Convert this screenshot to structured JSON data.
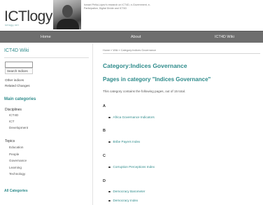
{
  "site": {
    "logo": "ICTlogy",
    "logo_sub": "ictlogy.net",
    "tagline": "Ismael Peña-López's research on ICT4D, e-Government, e-Participation, Digital Divide and ICT4D"
  },
  "nav": {
    "items": [
      "Home",
      "About",
      "ICT4D Wiki"
    ]
  },
  "sidebar": {
    "title": "ICT4D Wiki",
    "search_placeholder": "",
    "search_button": "Search Indices",
    "links": [
      "Other indices",
      "Related Changes"
    ],
    "main_categories_heading": "Main categories",
    "groups": [
      {
        "label": "Disciplines",
        "items": [
          "ICT4D",
          "ICT",
          "Development"
        ]
      },
      {
        "label": "Topics",
        "items": [
          "Education",
          "People",
          "Governance",
          "Learning",
          "Technology"
        ]
      }
    ],
    "all_categories": "All Categories"
  },
  "main": {
    "breadcrumb": "Home » Wiki » Category:Indices Governance",
    "category_title": "Category:Indices Governance",
    "pages_title": "Pages in category \"Indices Governance\"",
    "pages_description": "This category contains the following pages, out of 15 total.",
    "sections": [
      {
        "letter": "A",
        "entries": [
          "Africa Governance Indicators"
        ]
      },
      {
        "letter": "B",
        "entries": [
          "Bribe Payers Index"
        ]
      },
      {
        "letter": "C",
        "entries": [
          "Corruption Perceptions Index"
        ]
      },
      {
        "letter": "D",
        "entries": [
          "Democracy Barometer",
          "Democracy Index"
        ]
      }
    ]
  }
}
